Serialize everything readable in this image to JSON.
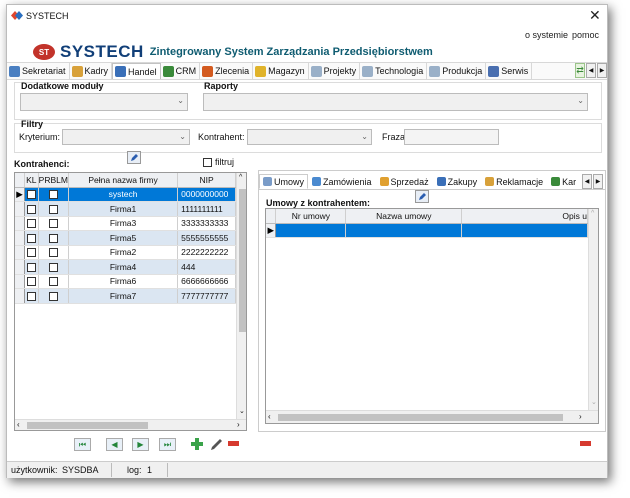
{
  "window": {
    "title": "SYSTECH"
  },
  "topmenu": {
    "about": "o systemie",
    "help": "pomoc"
  },
  "banner": {
    "logo_text": "ST",
    "brand": "SYSTECH",
    "subtitle": "Zintegrowany System Zarządzania Przedsiębiorstwem"
  },
  "toolbar": {
    "items": [
      {
        "label": "Sekretariat",
        "icon": "secretariat-icon",
        "color": "#4a7fc1"
      },
      {
        "label": "Kadry",
        "icon": "people-icon",
        "color": "#d8a13a"
      },
      {
        "label": "Handel",
        "icon": "trade-icon",
        "color": "#3a6fb8"
      },
      {
        "label": "CRM",
        "icon": "crm-chart-icon",
        "color": "#3a8a3a"
      },
      {
        "label": "Zlecenia",
        "icon": "orders-icon",
        "color": "#d35a1f"
      },
      {
        "label": "Magazyn",
        "icon": "warehouse-icon",
        "color": "#e0b32a"
      },
      {
        "label": "Projekty",
        "icon": "projects-icon",
        "color": "#9ab0c8"
      },
      {
        "label": "Technologia",
        "icon": "technology-icon",
        "color": "#9ab0c8"
      },
      {
        "label": "Produkcja",
        "icon": "production-icon",
        "color": "#9ab0c8"
      },
      {
        "label": "Serwis",
        "icon": "service-icon",
        "color": "#4a6fb0"
      }
    ],
    "active": "Handel"
  },
  "modules": {
    "label": "Dodatkowe moduły",
    "value": ""
  },
  "reports": {
    "label": "Raporty",
    "value": ""
  },
  "filters": {
    "label": "Filtry",
    "criterion_label": "Kryterium:",
    "criterion_value": "",
    "contractor_label": "Kontrahent:",
    "contractor_value": "",
    "phrase_label": "Fraza:",
    "phrase_value": ""
  },
  "contractors": {
    "label": "Kontrahenci:",
    "filter_label": "filtruj",
    "columns": [
      "KL",
      "PRBLM",
      "Pełna nazwa firmy",
      "NIP"
    ],
    "rows": [
      {
        "name": "systech",
        "nip": "0000000000",
        "selected": true
      },
      {
        "name": "Firma1",
        "nip": "1111111111"
      },
      {
        "name": "Firma3",
        "nip": "3333333333"
      },
      {
        "name": "Firma5",
        "nip": "5555555555"
      },
      {
        "name": "Firma2",
        "nip": "2222222222"
      },
      {
        "name": "Firma4",
        "nip": "444"
      },
      {
        "name": "Firma6",
        "nip": "6666666666"
      },
      {
        "name": "Firma7",
        "nip": "7777777777"
      }
    ]
  },
  "tabs": {
    "items": [
      {
        "label": "Umowy",
        "icon": "contracts-icon",
        "color": "#7a9cc8"
      },
      {
        "label": "Zamówienia",
        "icon": "orders-tab-icon",
        "color": "#4a8ad0"
      },
      {
        "label": "Sprzedaż",
        "icon": "sales-icon",
        "color": "#e0a030"
      },
      {
        "label": "Zakupy",
        "icon": "purchases-icon",
        "color": "#3a6fb8"
      },
      {
        "label": "Reklamacje",
        "icon": "complaints-icon",
        "color": "#d8a13a"
      },
      {
        "label": "Kar",
        "icon": "cards-icon",
        "color": "#3a8a3a"
      }
    ],
    "active": "Umowy"
  },
  "contracts": {
    "label": "Umowy z kontrahentem:",
    "columns": [
      "Nr umowy",
      "Nazwa umowy",
      "Opis u"
    ]
  },
  "status": {
    "user_label": "użytkownik:",
    "user": "SYSDBA",
    "log_label": "log:",
    "log": "1"
  }
}
